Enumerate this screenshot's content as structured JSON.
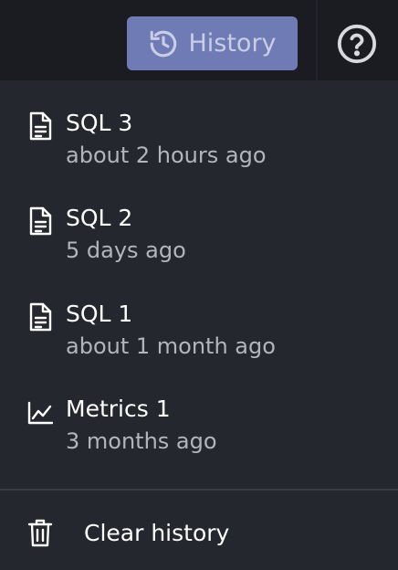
{
  "header": {
    "history_button": {
      "label": "History",
      "icon": "history-icon"
    },
    "help_button": {
      "icon": "help-circle-icon"
    }
  },
  "history_menu": {
    "items": [
      {
        "title": "SQL 3",
        "subtitle": "about 2 hours ago",
        "icon": "document-icon"
      },
      {
        "title": "SQL 2",
        "subtitle": "5 days ago",
        "icon": "document-icon"
      },
      {
        "title": "SQL 1",
        "subtitle": "about 1 month ago",
        "icon": "document-icon"
      },
      {
        "title": "Metrics 1",
        "subtitle": "3 months ago",
        "icon": "line-chart-icon"
      }
    ],
    "clear_label": "Clear history",
    "clear_icon": "trash-icon"
  },
  "colors": {
    "topbar_bg": "#1a1c22",
    "menu_bg": "#25272f",
    "history_button_bg": "#6f7bb4",
    "history_button_text": "#c9cde6",
    "title_text": "#ffffff",
    "subtitle_text": "#b3b5be"
  }
}
